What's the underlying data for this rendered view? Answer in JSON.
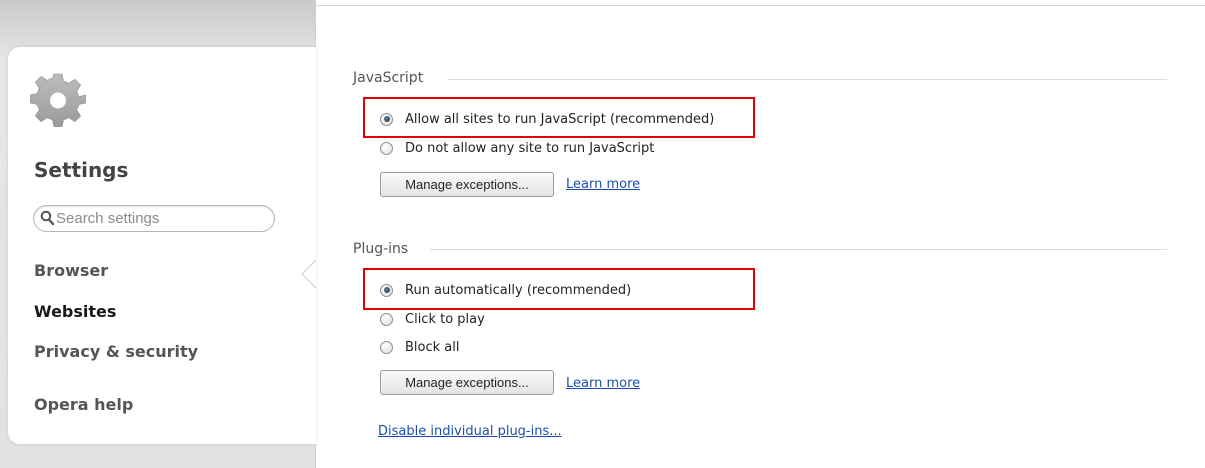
{
  "sidebar": {
    "title": "Settings",
    "search_placeholder": "Search settings",
    "items": [
      {
        "label": "Browser"
      },
      {
        "label": "Websites"
      },
      {
        "label": "Privacy & security"
      },
      {
        "label": "Opera help"
      }
    ],
    "active_item": "Websites"
  },
  "javascript": {
    "title": "JavaScript",
    "options": [
      {
        "label": "Allow all sites to run JavaScript (recommended)",
        "checked": true
      },
      {
        "label": "Do not allow any site to run JavaScript",
        "checked": false
      }
    ],
    "manage_exceptions_label": "Manage exceptions...",
    "learn_more_label": "Learn more"
  },
  "plugins": {
    "title": "Plug-ins",
    "options": [
      {
        "label": "Run automatically (recommended)",
        "checked": true
      },
      {
        "label": "Click to play",
        "checked": false
      },
      {
        "label": "Block all",
        "checked": false
      }
    ],
    "manage_exceptions_label": "Manage exceptions...",
    "learn_more_label": "Learn more",
    "disable_individual_label": "Disable individual plug-ins..."
  },
  "colors": {
    "highlight": "#e00000",
    "link": "#1a4fb0"
  }
}
